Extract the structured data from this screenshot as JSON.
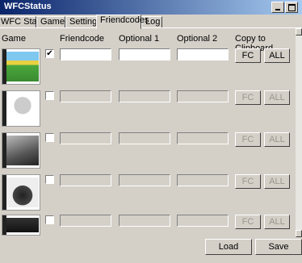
{
  "window": {
    "title": "WFCStatus"
  },
  "tabs": [
    {
      "label": "WFC Status"
    },
    {
      "label": "Games"
    },
    {
      "label": "Settings"
    },
    {
      "label": "Friendcodes"
    },
    {
      "label": "Log"
    }
  ],
  "active_tab": "Friendcodes",
  "headers": {
    "game": "Game",
    "friendcode": "Friendcode",
    "optional1": "Optional 1",
    "optional2": "Optional 2",
    "clipboard": "Copy to Clipboard"
  },
  "rows": [
    {
      "game_art": "animal-crossing",
      "checked": true,
      "check_mark": "✔",
      "friendcode": "",
      "optional1": "",
      "optional2": "",
      "fc_label": "FC",
      "all_label": "ALL"
    },
    {
      "game_art": "contact",
      "checked": false,
      "check_mark": "",
      "friendcode": "",
      "optional1": "",
      "optional2": "",
      "fc_label": "FC",
      "all_label": "ALL"
    },
    {
      "game_art": "lost-magic",
      "checked": false,
      "check_mark": "",
      "friendcode": "",
      "optional1": "",
      "optional2": "",
      "fc_label": "FC",
      "all_label": "ALL"
    },
    {
      "game_art": "mario-kart-ds",
      "checked": false,
      "check_mark": "",
      "friendcode": "",
      "optional1": "",
      "optional2": "",
      "fc_label": "FC",
      "all_label": "ALL"
    },
    {
      "game_art": "metroid",
      "checked": false,
      "check_mark": "",
      "friendcode": "",
      "optional1": "",
      "optional2": "",
      "fc_label": "FC",
      "all_label": "ALL"
    }
  ],
  "buttons": {
    "load": "Load",
    "save": "Save"
  }
}
